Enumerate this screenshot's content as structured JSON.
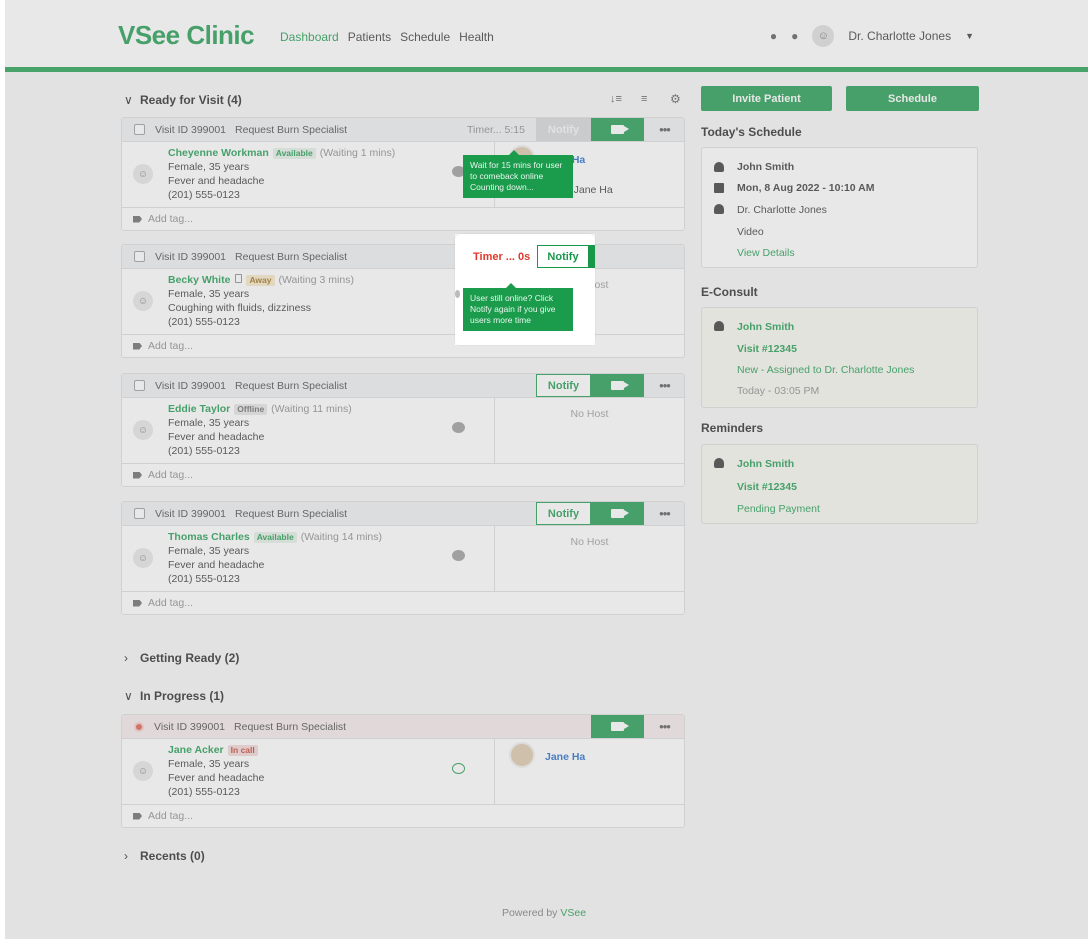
{
  "header": {
    "logo": "VSee Clinic",
    "nav": [
      "Dashboard",
      "Patients",
      "Schedule",
      "Health"
    ],
    "user_name": "Dr. Charlotte Jones"
  },
  "sections": {
    "ready": "Ready for Visit (4)",
    "getting_ready": "Getting Ready (2)",
    "in_progress": "In Progress (1)",
    "recents": "Recents (0)"
  },
  "visits": [
    {
      "id_label": "Visit ID 399001",
      "reason": "Request Burn Specialist",
      "timer": "Timer... 5:15",
      "notify": "Notify",
      "name": "Cheyenne Workman",
      "status": "Available",
      "wait": "(Waiting 1 mins)",
      "line1": "Female, 35 years",
      "line2": "Fever and headache",
      "phone": "(201) 555-0123",
      "host": "Jane Ha",
      "host_sub": "on by Jane Ha",
      "tag": "Add tag..."
    },
    {
      "id_label": "Visit ID 399001",
      "reason": "Request Burn Specialist",
      "timer": "Timer ... 0s",
      "notify": "Notify",
      "name": "Becky White",
      "status": "Away",
      "wait": "(Waiting 3 mins)",
      "line1": "Female, 35 years",
      "line2": "Coughing with fluids, dizziness",
      "phone": "(201) 555-0123",
      "host": "No Host",
      "tag": "Add tag..."
    },
    {
      "id_label": "Visit ID 399001",
      "reason": "Request Burn Specialist",
      "notify": "Notify",
      "name": "Eddie Taylor",
      "status": "Offline",
      "wait": "(Waiting 11 mins)",
      "line1": "Female, 35 years",
      "line2": "Fever and headache",
      "phone": "(201) 555-0123",
      "host": "No Host",
      "tag": "Add tag..."
    },
    {
      "id_label": "Visit ID 399001",
      "reason": "Request Burn Specialist",
      "notify": "Notify",
      "name": "Thomas Charles",
      "status": "Available",
      "wait": "(Waiting 14 mins)",
      "line1": "Female, 35 years",
      "line2": "Fever and headache",
      "phone": "(201) 555-0123",
      "host": "No Host",
      "tag": "Add tag..."
    }
  ],
  "in_progress_visit": {
    "id_label": "Visit ID 399001",
    "reason": "Request Burn Specialist",
    "name": "Jane Acker",
    "status": "In call",
    "line1": "Female, 35 years",
    "line2": "Fever and headache",
    "phone": "(201) 555-0123",
    "host": "Jane Ha",
    "tag": "Add tag..."
  },
  "tooltips": {
    "first": "Wait for 15 mins for user to comeback online Counting down...",
    "second": "User still online? Click Notify again if you give users more time"
  },
  "right": {
    "invite_button": "Invite Patient",
    "schedule_button": "Schedule",
    "today_title": "Today's Schedule",
    "today": {
      "patient": "John Smith",
      "datetime": "Mon, 8 Aug 2022 - 10:10 AM",
      "doctor": "Dr. Charlotte Jones",
      "type": "Video",
      "details": "View Details"
    },
    "econsult_title": "E-Consult",
    "econsult": {
      "patient": "John Smith",
      "visit": "Visit #12345",
      "status": "New - Assigned to Dr. Charlotte Jones",
      "time": "Today - 03:05 PM"
    },
    "reminders_title": "Reminders",
    "reminders": {
      "patient": "John Smith",
      "visit": "Visit #12345",
      "status": "Pending Payment"
    }
  },
  "footer": {
    "text": "Powered by",
    "brand": "VSee"
  },
  "colors": {
    "brand_green": "#19984b",
    "timer_red": "#e0392b",
    "host_blue": "#1a66c9"
  }
}
